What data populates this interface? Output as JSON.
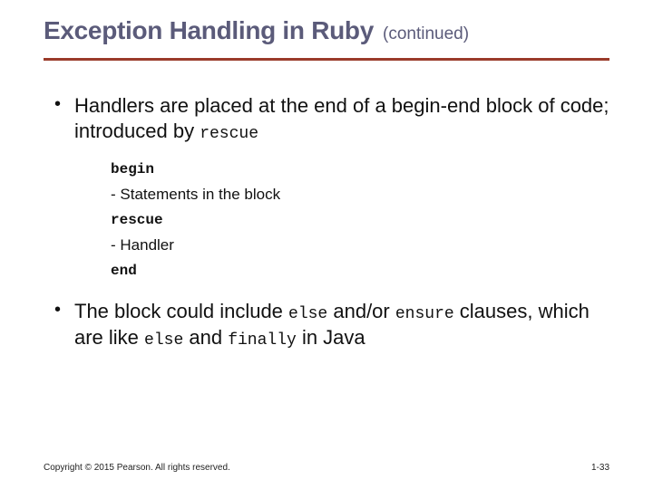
{
  "title": "Exception Handling in Ruby",
  "continued": "(continued)",
  "bullets": {
    "b1": {
      "pre": "Handlers are placed at the end of a begin-end block of code; introduced by ",
      "kw": "rescue"
    },
    "code": {
      "l1": "begin",
      "l2": "- Statements in the block",
      "l3": "rescue",
      "l4": "- Handler",
      "l5": "end"
    },
    "b2": {
      "s1": "The block could include ",
      "k1": "else",
      "s2": " and/or ",
      "k2": "ensure",
      "s3": " clauses, which are like ",
      "k3": "else",
      "s4": " and ",
      "k4": "finally",
      "s5": " in Java"
    }
  },
  "footer": {
    "copyright": "Copyright © 2015 Pearson. All rights reserved.",
    "pagenum": "1-33"
  }
}
